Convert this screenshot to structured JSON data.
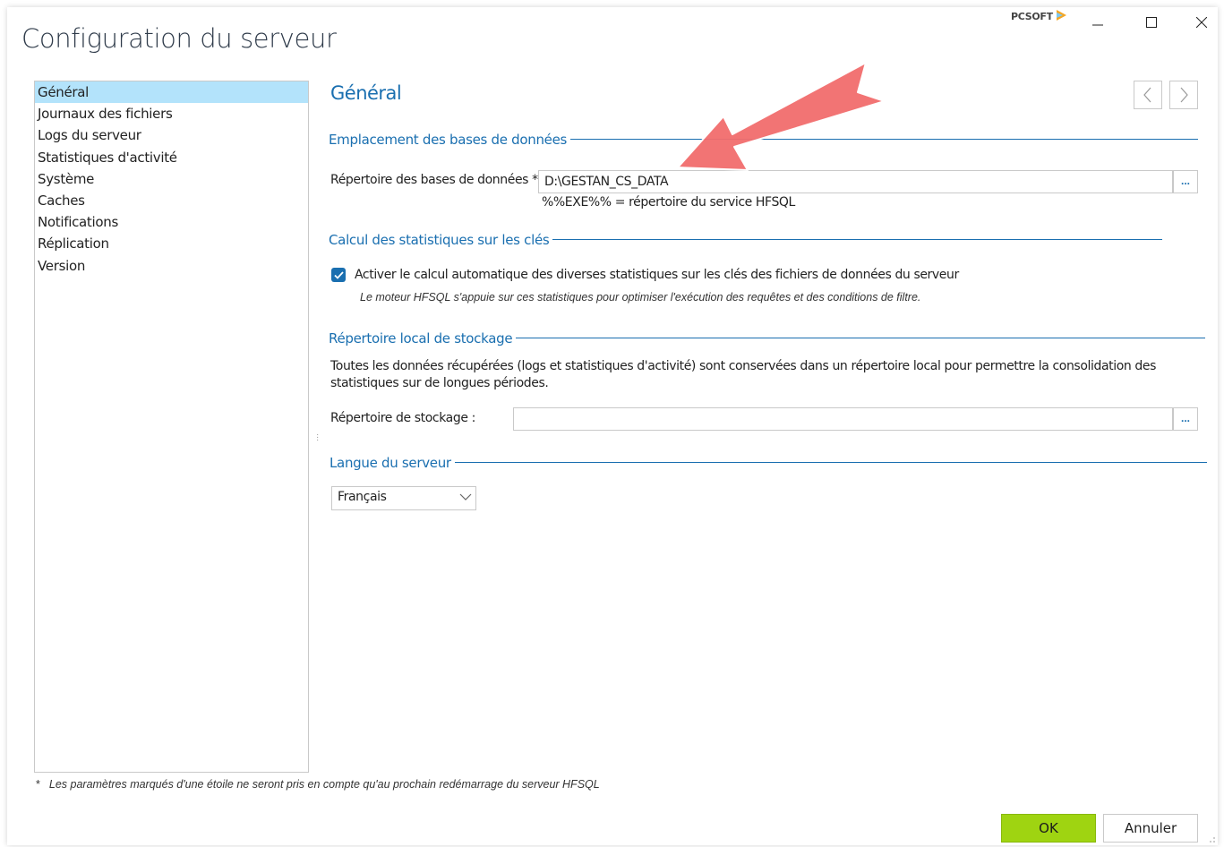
{
  "window": {
    "title": "Configuration du serveur",
    "brand": "PCSOFT",
    "controls": {
      "minimize": "minimize-icon",
      "maximize": "maximize-icon",
      "close": "close-icon"
    }
  },
  "sidebar": {
    "items": [
      {
        "label": "Général",
        "selected": true
      },
      {
        "label": "Journaux des fichiers"
      },
      {
        "label": "Logs du serveur"
      },
      {
        "label": "Statistiques d'activité"
      },
      {
        "label": "Système"
      },
      {
        "label": "Caches"
      },
      {
        "label": "Notifications"
      },
      {
        "label": "Réplication"
      },
      {
        "label": "Version"
      }
    ]
  },
  "main": {
    "heading": "Général",
    "db_location": {
      "title": "Emplacement des bases de données",
      "label": "Répertoire des bases de données * :",
      "value": "D:\\GESTAN_CS_DATA",
      "browse": "...",
      "hint": "%%EXE%% = répertoire du service HFSQL"
    },
    "key_stats": {
      "title": "Calcul des statistiques sur les clés",
      "checkbox_label": "Activer le calcul automatique des diverses statistiques sur les clés des fichiers de données du serveur",
      "checked": true,
      "note": "Le moteur HFSQL s'appuie sur ces statistiques pour optimiser l'exécution des requêtes et des conditions de filtre."
    },
    "local_storage": {
      "title": "Répertoire local de stockage",
      "description": "Toutes les données récupérées (logs et statistiques d'activité) sont conservées dans un répertoire local pour permettre la consolidation des statistiques sur de longues périodes.",
      "label": "Répertoire de stockage :",
      "value": "",
      "browse": "..."
    },
    "language": {
      "title": "Langue du serveur",
      "selected": "Français"
    }
  },
  "footer": {
    "star": "*",
    "note": "Les paramètres marqués d'une étoile ne seront pris en compte qu'au prochain redémarrage du serveur HFSQL",
    "ok": "OK",
    "cancel": "Annuler"
  },
  "colors": {
    "accent": "#1a6fb0",
    "selection": "#b3e3fb",
    "ok_button": "#9fd411",
    "annotation_arrow": "#f26d6d"
  }
}
